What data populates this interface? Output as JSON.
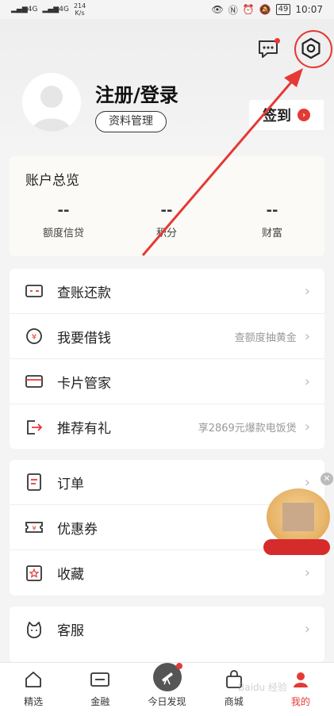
{
  "status_bar": {
    "signal_1": "4G",
    "signal_2": "4G",
    "net_speed_value": "214",
    "net_speed_unit": "K/s",
    "battery": "49",
    "time": "10:07"
  },
  "header": {
    "login_title": "注册/登录",
    "profile_button": "资料管理",
    "signin_button": "签到"
  },
  "account": {
    "title": "账户总览",
    "stats": [
      {
        "value": "--",
        "label": "额度信贷"
      },
      {
        "value": "--",
        "label": "积分"
      },
      {
        "value": "--",
        "label": "财富"
      }
    ]
  },
  "menu_group_1": [
    {
      "label": "查账还款",
      "hint": "",
      "icon": "bill-icon"
    },
    {
      "label": "我要借钱",
      "hint": "查额度抽黄金",
      "icon": "loan-icon"
    },
    {
      "label": "卡片管家",
      "hint": "",
      "icon": "card-icon"
    },
    {
      "label": "推荐有礼",
      "hint": "享2869元爆款电饭煲",
      "icon": "share-icon"
    }
  ],
  "menu_group_2": [
    {
      "label": "订单",
      "icon": "order-icon"
    },
    {
      "label": "优惠券",
      "icon": "coupon-icon"
    },
    {
      "label": "收藏",
      "icon": "favorite-icon"
    }
  ],
  "menu_group_3": [
    {
      "label": "客服",
      "icon": "customer-service-icon"
    }
  ],
  "tabbar": [
    {
      "label": "精选",
      "icon": "home-icon",
      "active": false
    },
    {
      "label": "金融",
      "icon": "finance-icon",
      "active": false
    },
    {
      "label": "今日发现",
      "icon": "telescope-icon",
      "active": false
    },
    {
      "label": "商城",
      "icon": "shop-bag-icon",
      "active": false
    },
    {
      "label": "我的",
      "icon": "profile-icon",
      "active": true
    }
  ],
  "watermark": "Baidu 经验",
  "colors": {
    "accent": "#e53935",
    "background": "#f4f4f4"
  }
}
